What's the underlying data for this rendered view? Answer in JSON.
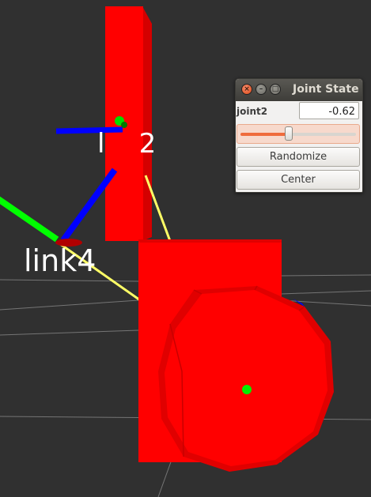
{
  "viewport": {
    "labels": {
      "link2": "l    2",
      "link4": "link4"
    }
  },
  "panel": {
    "title": "Joint State",
    "close_glyph": "×",
    "min_glyph": "–",
    "max_glyph": "□",
    "joint": {
      "name": "joint2",
      "value": "-0.62",
      "slider_fraction": 0.42
    },
    "buttons": {
      "randomize": "Randomize",
      "center": "Center"
    }
  },
  "colors": {
    "background": "#303030",
    "link": "#ff0000",
    "link_shade": "#d40000",
    "axis_x": "#ff0000",
    "axis_y": "#00ff00",
    "axis_z": "#0000ff",
    "connector": "#ffff66",
    "label": "#ffffff",
    "accent": "#ef6c3c"
  }
}
